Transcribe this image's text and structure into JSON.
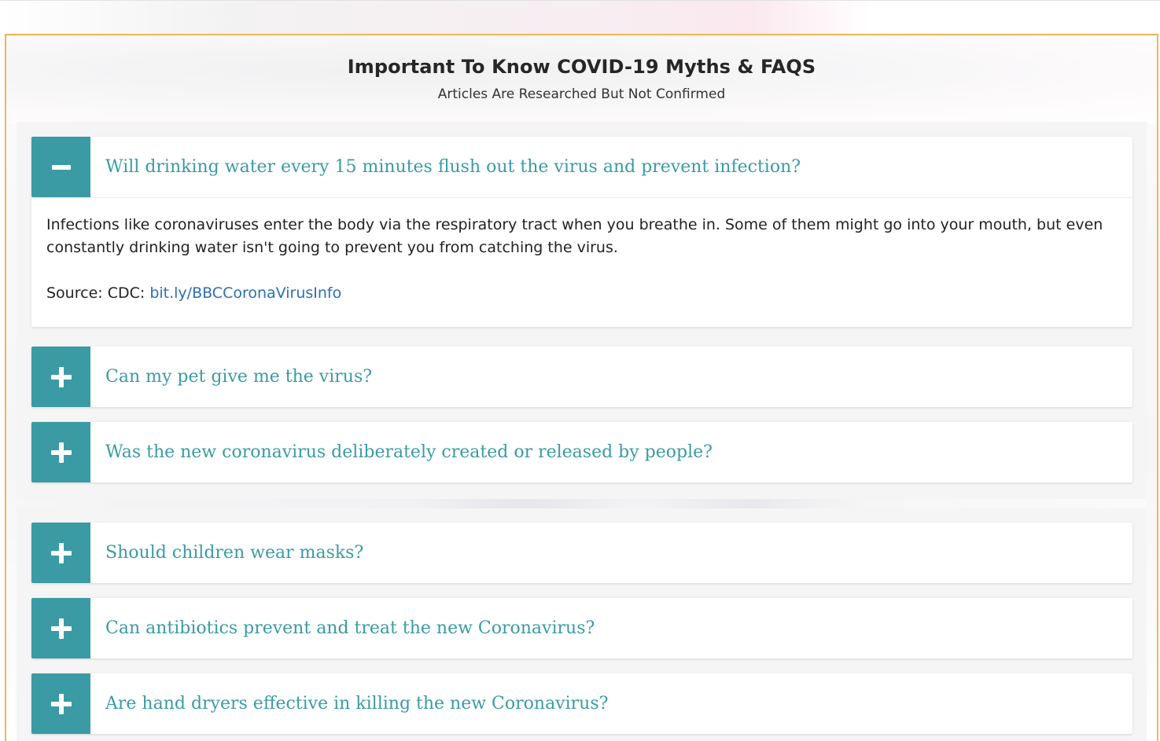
{
  "header": {
    "title": "Important To Know COVID-19 Myths & FAQS",
    "subtitle": "Articles Are Researched But Not Confirmed"
  },
  "colors": {
    "accent": "#3a9ba5",
    "frame_border": "#f4b35a",
    "link": "#2e6fb0"
  },
  "faqs": [
    {
      "question": "Will drinking water every 15 minutes flush out the virus and prevent infection?",
      "expanded": true,
      "toggle_icon": "minus-icon",
      "answer": "Infections like coronaviruses enter the body via the respiratory tract when you breathe in. Some of them might go into your mouth, but even constantly drinking water isn't going to prevent you from catching the virus.",
      "source_label": "Source: CDC:",
      "source_link": "bit.ly/BBCCoronaVirusInfo"
    },
    {
      "question": "Can my pet give me the virus?",
      "expanded": false,
      "toggle_icon": "plus-icon"
    },
    {
      "question": "Was the new coronavirus deliberately created or released by people?",
      "expanded": false,
      "toggle_icon": "plus-icon"
    },
    {
      "question": "Should children wear masks?",
      "expanded": false,
      "toggle_icon": "plus-icon"
    },
    {
      "question": "Can antibiotics prevent and treat the new Coronavirus?",
      "expanded": false,
      "toggle_icon": "plus-icon"
    },
    {
      "question": "Are hand dryers effective in killing the new Coronavirus?",
      "expanded": false,
      "toggle_icon": "plus-icon"
    }
  ]
}
